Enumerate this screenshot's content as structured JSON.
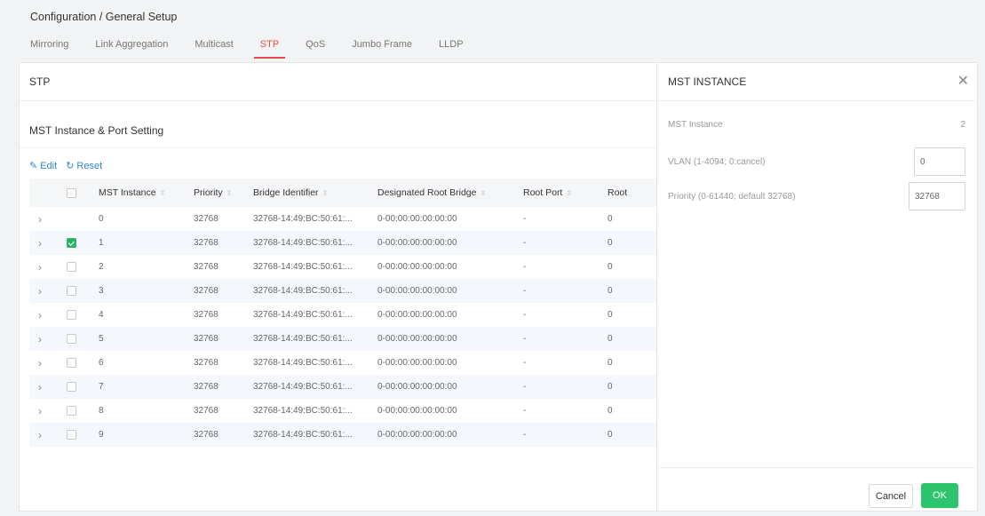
{
  "breadcrumb": "Configuration / General Setup",
  "tabs": [
    "Mirroring",
    "Link Aggregation",
    "Multicast",
    "STP",
    "QoS",
    "Jumbo Frame",
    "LLDP"
  ],
  "active_tab": "STP",
  "left_panel": {
    "title": "STP",
    "section_title": "MST Instance & Port Setting",
    "edit_label": "Edit",
    "reset_label": "Reset",
    "columns": [
      "MST Instance",
      "Priority",
      "Bridge Identifier",
      "Designated Root Bridge",
      "Root Port",
      "Root"
    ],
    "rows": [
      {
        "mst": "0",
        "priority": "32768",
        "bridge": "32768-14:49:BC:50:61:...",
        "droot": "0-00:00:00:00:00:00",
        "rport": "-",
        "rcost": "0",
        "checked": false,
        "checkbox": false
      },
      {
        "mst": "1",
        "priority": "32768",
        "bridge": "32768-14:49:BC:50:61:...",
        "droot": "0-00:00:00:00:00:00",
        "rport": "-",
        "rcost": "0",
        "checked": true,
        "checkbox": true
      },
      {
        "mst": "2",
        "priority": "32768",
        "bridge": "32768-14:49:BC:50:61:...",
        "droot": "0-00:00:00:00:00:00",
        "rport": "-",
        "rcost": "0",
        "checked": false,
        "checkbox": true
      },
      {
        "mst": "3",
        "priority": "32768",
        "bridge": "32768-14:49:BC:50:61:...",
        "droot": "0-00:00:00:00:00:00",
        "rport": "-",
        "rcost": "0",
        "checked": false,
        "checkbox": true
      },
      {
        "mst": "4",
        "priority": "32768",
        "bridge": "32768-14:49:BC:50:61:...",
        "droot": "0-00:00:00:00:00:00",
        "rport": "-",
        "rcost": "0",
        "checked": false,
        "checkbox": true
      },
      {
        "mst": "5",
        "priority": "32768",
        "bridge": "32768-14:49:BC:50:61:...",
        "droot": "0-00:00:00:00:00:00",
        "rport": "-",
        "rcost": "0",
        "checked": false,
        "checkbox": true
      },
      {
        "mst": "6",
        "priority": "32768",
        "bridge": "32768-14:49:BC:50:61:...",
        "droot": "0-00:00:00:00:00:00",
        "rport": "-",
        "rcost": "0",
        "checked": false,
        "checkbox": true
      },
      {
        "mst": "7",
        "priority": "32768",
        "bridge": "32768-14:49:BC:50:61:...",
        "droot": "0-00:00:00:00:00:00",
        "rport": "-",
        "rcost": "0",
        "checked": false,
        "checkbox": true
      },
      {
        "mst": "8",
        "priority": "32768",
        "bridge": "32768-14:49:BC:50:61:...",
        "droot": "0-00:00:00:00:00:00",
        "rport": "-",
        "rcost": "0",
        "checked": false,
        "checkbox": true
      },
      {
        "mst": "9",
        "priority": "32768",
        "bridge": "32768-14:49:BC:50:61:...",
        "droot": "0-00:00:00:00:00:00",
        "rport": "-",
        "rcost": "0",
        "checked": false,
        "checkbox": true
      }
    ]
  },
  "right_panel": {
    "title": "MST INSTANCE",
    "mst_label": "MST Instance",
    "mst_value": "2",
    "vlan_label": "VLAN (1-4094; 0:cancel)",
    "vlan_value": "0",
    "priority_label": "Priority (0-61440; default 32768)",
    "priority_value": "32768",
    "cancel_label": "Cancel",
    "ok_label": "OK"
  },
  "colors": {
    "accent": "#e64b4b",
    "ok": "#2dc46e",
    "link": "#2f86d6",
    "checked": "#2cb36b"
  }
}
